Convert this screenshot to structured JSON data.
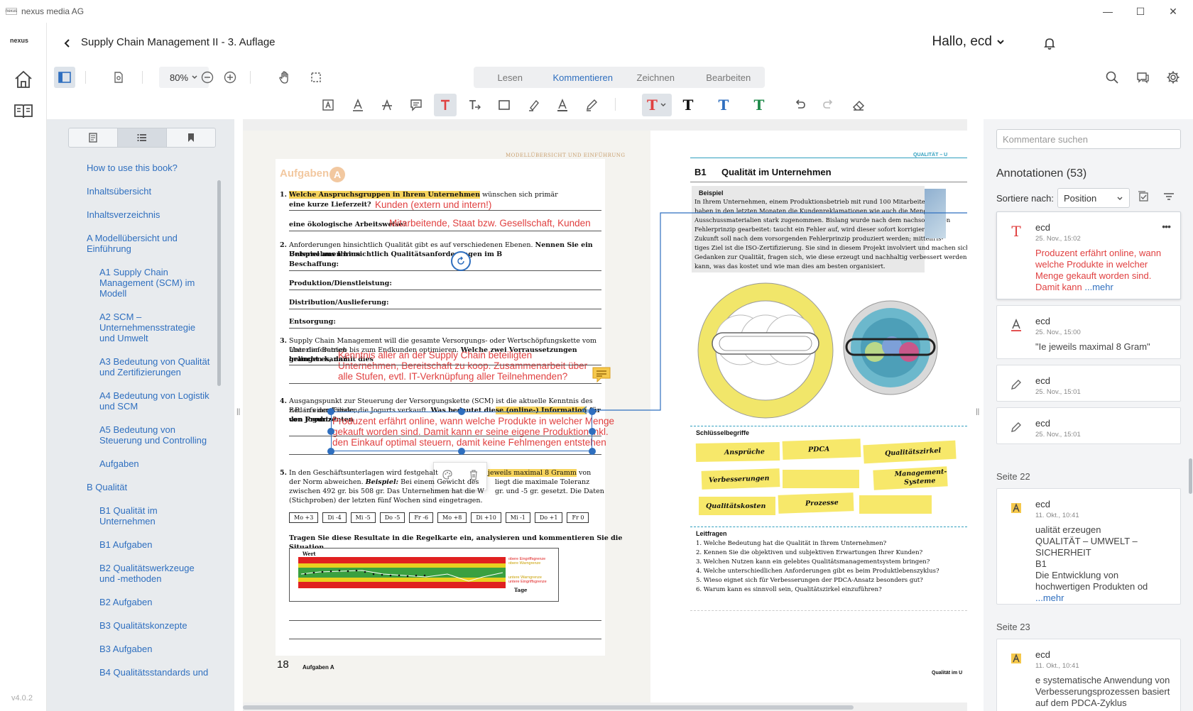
{
  "window": {
    "app_name": "nexus media AG",
    "app_icon_text": "nexus",
    "controls": {
      "minimize": "—",
      "maximize": "☐",
      "close": "✕"
    }
  },
  "rail": {
    "logo": "nexus",
    "version": "v4.0.2"
  },
  "header": {
    "title": "Supply Chain Management II - 3. Auflage",
    "greeting": "Hallo, ecd"
  },
  "toolbar": {
    "zoom": "80%",
    "modes": [
      "Lesen",
      "Kommentieren",
      "Zeichnen",
      "Bearbeiten"
    ],
    "active_mode": "Kommentieren"
  },
  "colors": {
    "accent": "#2f6fbf",
    "annotation_red": "#e04040",
    "text_black": "#111111",
    "text_blue": "#2f6fbf",
    "text_green": "#1f8a4a",
    "highlight_yellow": "#f7d45c"
  },
  "toc": {
    "items": [
      {
        "label": "How to use this book?",
        "level": 1
      },
      {
        "label": "Inhaltsübersicht",
        "level": 1
      },
      {
        "label": "Inhaltsverzeichnis",
        "level": 1
      },
      {
        "label": "A Modellübersicht und Einführung",
        "level": 1
      },
      {
        "label": "A1 Supply Chain Management (SCM) im Modell",
        "level": 2
      },
      {
        "label": "A2 SCM – Unternehmensstrategie und Umwelt",
        "level": 2
      },
      {
        "label": "A3 Bedeutung von Qualität und Zertifizierungen",
        "level": 2
      },
      {
        "label": "A4 Bedeutung von Logistik und SCM",
        "level": 2
      },
      {
        "label": "A5 Bedeutung von Steuerung und Controlling",
        "level": 2
      },
      {
        "label": "Aufgaben",
        "level": 2
      },
      {
        "label": "B Qualität",
        "level": 1
      },
      {
        "label": "B1 Qualität im Unternehmen",
        "level": 2
      },
      {
        "label": "B1 Aufgaben",
        "level": 2
      },
      {
        "label": "B2 Qualitätswerkzeuge und -methoden",
        "level": 2
      },
      {
        "label": "B2 Aufgaben",
        "level": 2
      },
      {
        "label": "B3 Qualitätskonzepte",
        "level": 2
      },
      {
        "label": "B3 Aufgaben",
        "level": 2
      },
      {
        "label": "B4 Qualitätsstandards und",
        "level": 2
      }
    ]
  },
  "left_page": {
    "header_text": "MODELLÜBERSICHT UND EINFÜHRUNG",
    "section": "Aufgaben",
    "badge": "A",
    "q1_a_hl": "Welche Anspruchsgruppen in Ihrem Unternehmen",
    "q1_a_rest": " wünschen sich primär",
    "q1_b": "eine kurze Lieferzeit?",
    "q1_c": "eine ökologische Arbeitsweise?",
    "q2_a": "Anforderungen hinsichtlich Qualität gibt es auf verschiedenen Ebenen. ",
    "q2_a_bold": "Nennen Sie ein Beispiel aus Ihrem",
    "q2_b": "Unternehmen hinsichtlich Qualitätsanforderungen im B",
    "q2_c": "Beschaffung:",
    "q2_d": "Produktion/Dienstleistung:",
    "q2_e": "Distribution/Auslieferung:",
    "q2_f": "Entsorgung:",
    "q3_a": "Supply Chain Management will die gesamte Versorgungs- oder Wertschöpfungskette vom Unterlieferanten",
    "q3_b": "über den Betrieb bis zum Endkunden optimieren. ",
    "q3_b_bold": "Welche zwei Vorraussetzungen braucht es, damit dies",
    "q3_c": "gelingen kann?",
    "q4_a": "Ausgangspunkt zur Steuerung der Versorgungskette (SCM) ist die aktuelle Kenntnis des Bedarfs der Kunden,",
    "q4_b_pre": "z.B. in einer Filiale, die Jogurts verkauft. ",
    "q4_b_bold": "Was bedeutet die",
    "q4_b_hl": "se (online-) Information",
    "q4_b_bold2": " für den Produzenten",
    "q4_c": "von Jogurts?",
    "q5_a": "In den Geschäftsunterlagen wird festgehalten, dass die",
    "q5_a_hl": "jeweils maximal 8 Gramm",
    "q5_a_rest": " von",
    "q5_b": "der Norm abweichen. ",
    "q5_b_it": "Beispiel:",
    "q5_b_rest": " Bei einem Gewicht des",
    "q5_b_tail": "liegt die maximale Toleranz",
    "q5_c": "zwischen 492 gr. bis 508 gr. Das Unternehmen hat die W",
    "q5_c_tail": "gr. und -5 gr. gesetzt. Die Daten",
    "q5_d": "(Stichproben) der letzten fünf Wochen sind eingetragen.",
    "q5_values": [
      "Mo +3",
      "Di -4",
      "Mi -5",
      "Do -5",
      "Fr -6",
      "Mo +8",
      "Di +10",
      "Mi -1",
      "Do +1",
      "Fr 0"
    ],
    "q5_task": "Tragen Sie diese Resultate in die Regelkarte ein, analysieren und kommentieren Sie die Situation.",
    "chart_axis_y": "Wert",
    "chart_axis_x": "Tage",
    "chart_legend": [
      "obere Eingriffsgrenze",
      "obere Warngrenze",
      "untere Warngrenze",
      "untere Eingriffsgrenze"
    ],
    "page_number": "18",
    "footer": "Aufgaben A",
    "hand_q1a": "Kunden (extern und intern!)",
    "hand_q1b": "Mitarbeitende, Staat bzw. Gesellschaft, Kunden",
    "hand_q3": [
      "Kenntnis aller an der Supply Chain beteiligten",
      "Unternehmen, Bereitschaft zu koop. Zusammenarbeit über",
      "alle Stufen, evtl. IT-Verknüpfung aller Teilnehmenden?"
    ],
    "hand_q4": [
      "Produzent erfährt online, wann welche Produkte in welcher Menge",
      "gekauft worden sind. Damit kann er seine eigene Produktion inkl.",
      "den Einkauf optimal steuern, damit keine Fehlmengen entstehen"
    ]
  },
  "right_page": {
    "header_text": "QUALITÄT – U",
    "chapter": "B1",
    "title": "Qualität im Unternehmen",
    "example_label": "Beispiel",
    "example_lines": [
      "In Ihrem Unternehmen, einem Produktionsbetrieb mit rund 100 Mitarbeitenden,",
      "haben in den letzten Monaten die Kundenreklamationen wie auch die Mengen an",
      "Ausschussmaterialien stark zugenommen. Bislang wurde nach dem nachsorgenden",
      "Fehlerprinzip gearbeitet: taucht ein Fehler auf, wird dieser sofort korrigiert – in",
      "Zukunft soll nach dem vorsorgenden Fehlerprinzip produziert werden; mittelfris-",
      "tiges Ziel ist die ISO-Zertifizierung. Sie sind in diesem Projekt involviert und machen sich",
      "Gedanken zur Qualität, fragen sich, wie diese erzeugt und nachhaltig verbessert werden",
      "kann, was das kostet und wie man dies am besten organisiert."
    ],
    "keywords_label": "Schlüsselbegriffe",
    "keywords": [
      "Ansprüche",
      "PDCA",
      "Qualitätszirkel",
      "Verbesserungen",
      "Management-Systeme",
      "Qualitätskosten",
      "Prozesse"
    ],
    "leitfragen_label": "Leitfragen",
    "leitfragen": [
      "1.  Welche Bedeutung hat die Qualität in Ihrem Unternehmen?",
      "2.  Kennen Sie die objektiven und subjektiven Erwartungen Ihrer Kunden?",
      "3.  Welchen Nutzen kann ein gelebtes Qualitätsmanagementsystem bringen?",
      "4.  Welche unterschiedlichen Anforderungen gibt es beim Produktlebenszyklus?",
      "5.  Wieso eignet sich für Verbesserungen der PDCA-Ansatz besonders gut?",
      "6.  Warum kann es sinnvoll sein, Qualitätszirkel einzuführen?"
    ],
    "footer": "Qualität im U"
  },
  "annotations": {
    "search_placeholder": "Kommentare suchen",
    "heading": "Annotationen (53)",
    "sort_label": "Sortiere nach:",
    "sort_value": "Position",
    "cards": [
      {
        "user": "ecd",
        "date": "25. Nov., 15:02",
        "text": "Produzent erfährt online, wann welche Produkte in welcher Menge gekauft worden sind. Damit kann",
        "more": " ...mehr",
        "menu": "•••"
      },
      {
        "user": "ecd",
        "date": "25. Nov., 15:00",
        "text": "\"Ie jeweils maximal 8 Gram\""
      },
      {
        "user": "ecd",
        "date": "25. Nov., 15:01"
      },
      {
        "user": "ecd",
        "date": "25. Nov., 15:01"
      }
    ],
    "page22": "Seite 22",
    "card_p22": {
      "user": "ecd",
      "date": "11. Okt., 10:41",
      "text_lines": [
        "ualität erzeugen",
        "QUALITÄT – UMWELT – SICHERHEIT",
        "B1",
        "Die Entwicklung von hochwertigen Produkten od"
      ],
      "more": "...mehr"
    },
    "page23": "Seite 23",
    "card_p23": {
      "user": "ecd",
      "date": "11. Okt., 10:41",
      "text_lines": [
        "e systematische Anwendung von Verbesserungsprozessen basiert auf dem PDCA-Zyklus"
      ]
    }
  }
}
